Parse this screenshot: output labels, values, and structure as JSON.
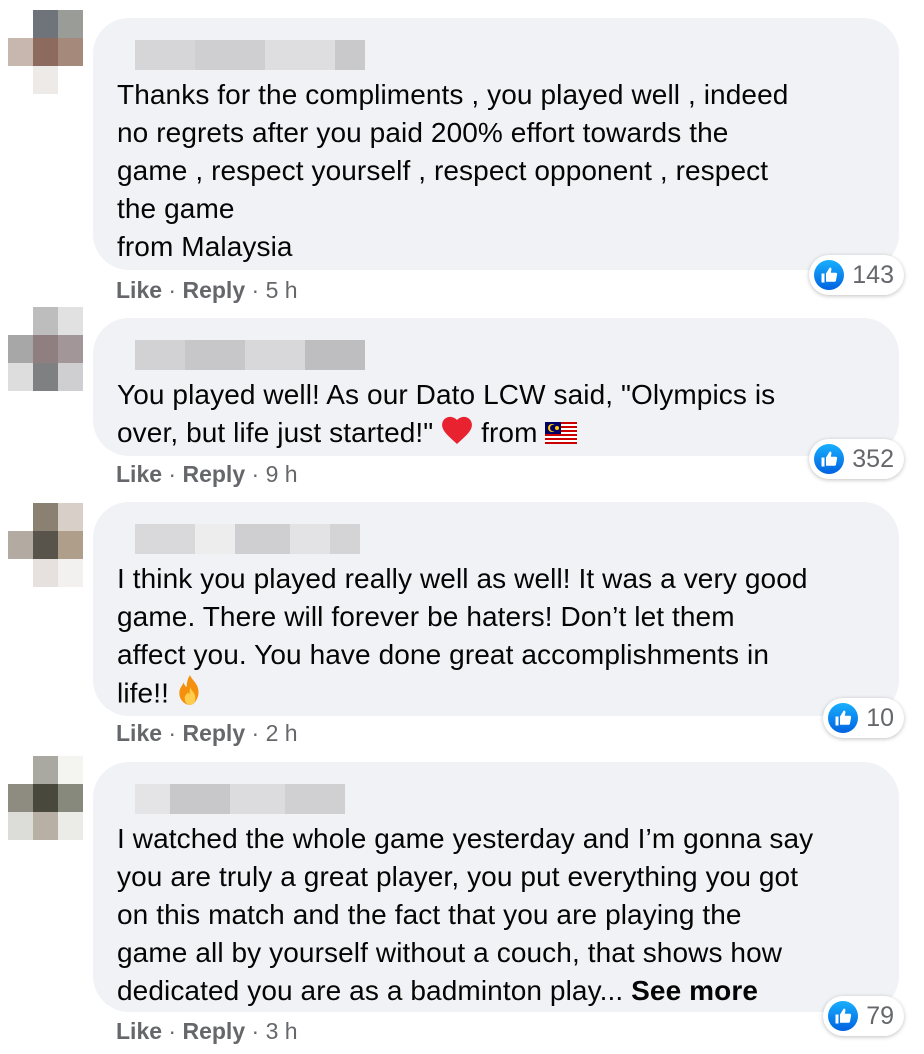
{
  "comments": [
    {
      "text": "Thanks for the compliments , you played well , indeed\nno regrets after you paid 200% effort towards the\ngame , respect yourself , respect opponent , respect\nthe game\nfrom Malaysia",
      "like": "Like",
      "reply": "Reply",
      "time": "5 h",
      "reactions": "143"
    },
    {
      "text_before": "You played well! As our Dato LCW said, \"Olympics is\nover, but life just started!\" ",
      "text_mid": " from ",
      "heart_emoji": "heart-emoji",
      "flag_emoji": "malaysia-flag-emoji",
      "like": "Like",
      "reply": "Reply",
      "time": "9 h",
      "reactions": "352"
    },
    {
      "text": "I think you played really well as well! It was a very good\ngame. There will forever be haters! Don’t let them\naffect you. You have done great accomplishments in\nlife!! ",
      "fire_emoji": "fire-emoji",
      "like": "Like",
      "reply": "Reply",
      "time": "2 h",
      "reactions": "10"
    },
    {
      "text": "I watched the whole game yesterday and I’m gonna say\nyou are truly a great player, you put everything you got\non this match and the fact that you are playing the\ngame all by yourself without a couch, that shows how\ndedicated you are as a badminton play... ",
      "see_more": "See more",
      "like": "Like",
      "reply": "Reply",
      "time": "3 h",
      "reactions": "79"
    }
  ],
  "separator": " · ",
  "colors": {
    "bubble": "#f0f2f5",
    "meta": "#65676b",
    "like_blue": "#1877f2"
  }
}
